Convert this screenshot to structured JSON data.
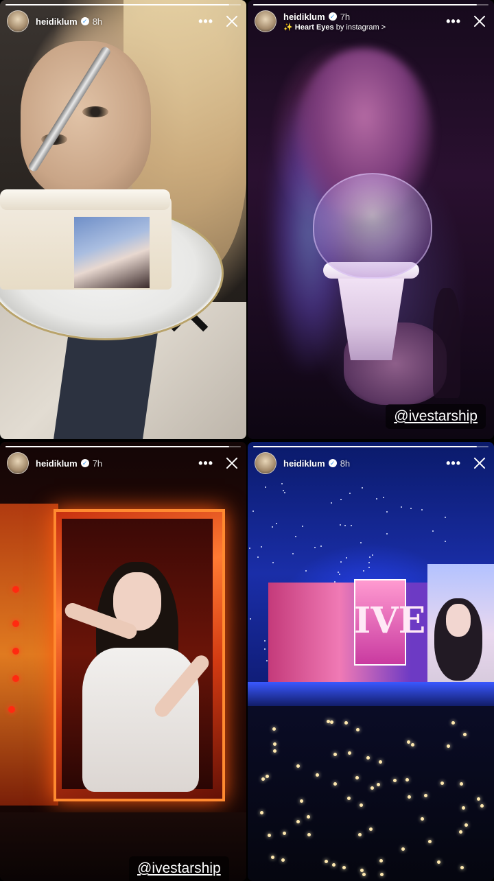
{
  "stories": [
    {
      "username": "heidiklum",
      "time": "8h",
      "progress": 0.95
    },
    {
      "username": "heidiklum",
      "time": "7h",
      "audio_icon": "sparkles-icon",
      "audio_title": "Heart Eyes",
      "audio_by": "by instagram",
      "audio_chevron": ">",
      "mention": "@ivestarship",
      "progress": 0.95
    },
    {
      "username": "heidiklum",
      "time": "7h",
      "mention": "@ivestarship",
      "progress": 0.95
    },
    {
      "username": "heidiklum",
      "time": "8h",
      "progress": 0.95
    }
  ],
  "icons": {
    "more": "•••",
    "verified": "✓"
  }
}
